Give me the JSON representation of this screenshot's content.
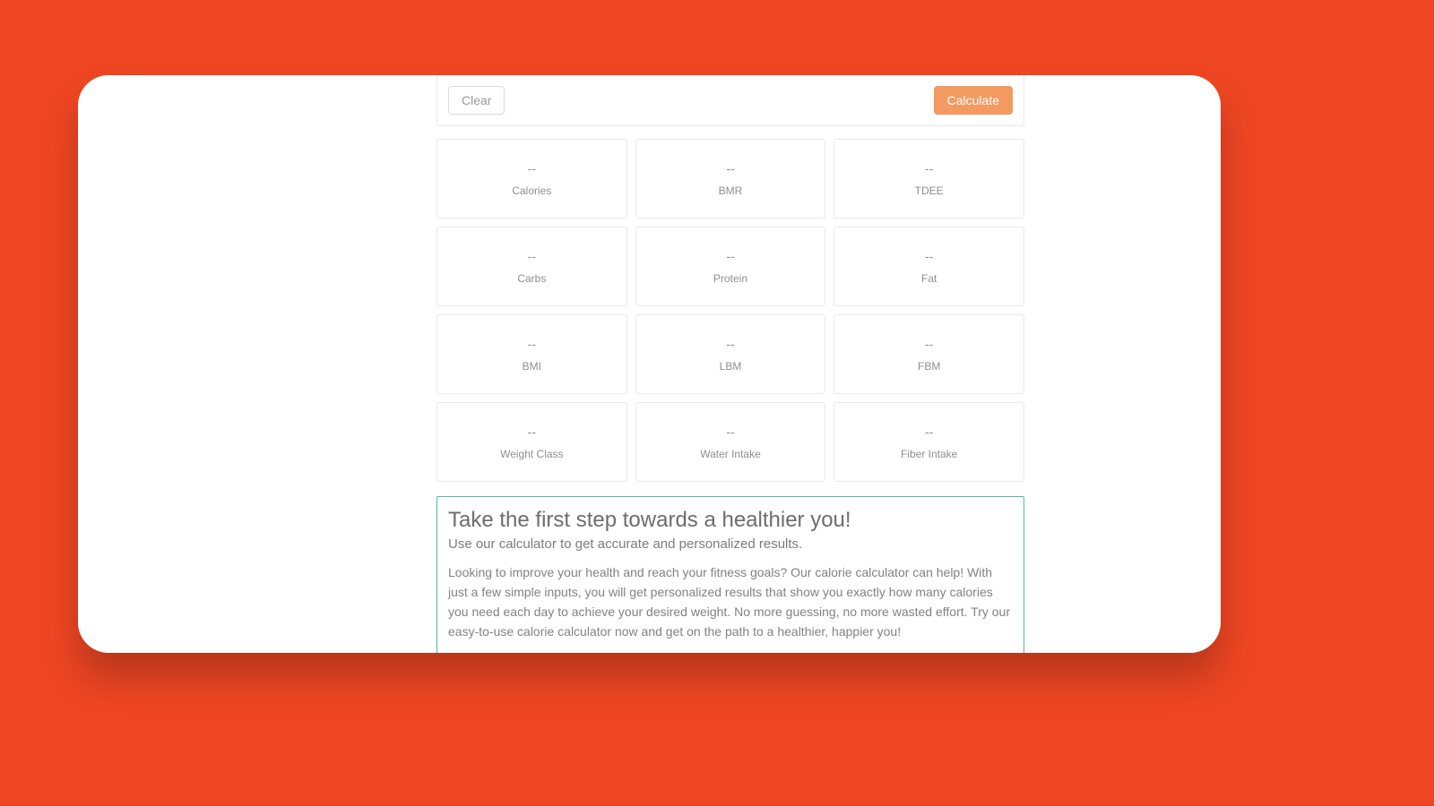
{
  "actions": {
    "clear_label": "Clear",
    "calculate_label": "Calculate"
  },
  "results": [
    {
      "value": "--",
      "label": "Calories"
    },
    {
      "value": "--",
      "label": "BMR"
    },
    {
      "value": "--",
      "label": "TDEE"
    },
    {
      "value": "--",
      "label": "Carbs"
    },
    {
      "value": "--",
      "label": "Protein"
    },
    {
      "value": "--",
      "label": "Fat"
    },
    {
      "value": "--",
      "label": "BMI"
    },
    {
      "value": "--",
      "label": "LBM"
    },
    {
      "value": "--",
      "label": "FBM"
    },
    {
      "value": "--",
      "label": "Weight Class"
    },
    {
      "value": "--",
      "label": "Water Intake"
    },
    {
      "value": "--",
      "label": "Fiber Intake"
    }
  ],
  "callout": {
    "heading": "Take the first step towards a healthier you!",
    "sub": "Use our calculator to get accurate and personalized results.",
    "body": "Looking to improve your health and reach your fitness goals? Our calorie calculator can help! With just a few simple inputs, you will get personalized results that show you exactly how many calories you need each day to achieve your desired weight. No more guessing, no more wasted effort. Try our easy-to-use calorie calculator now and get on the path to a healthier, happier you!"
  },
  "colors": {
    "bg": "#ee4623",
    "primary_btn": "#f29a60",
    "callout_border": "#55b99a"
  }
}
